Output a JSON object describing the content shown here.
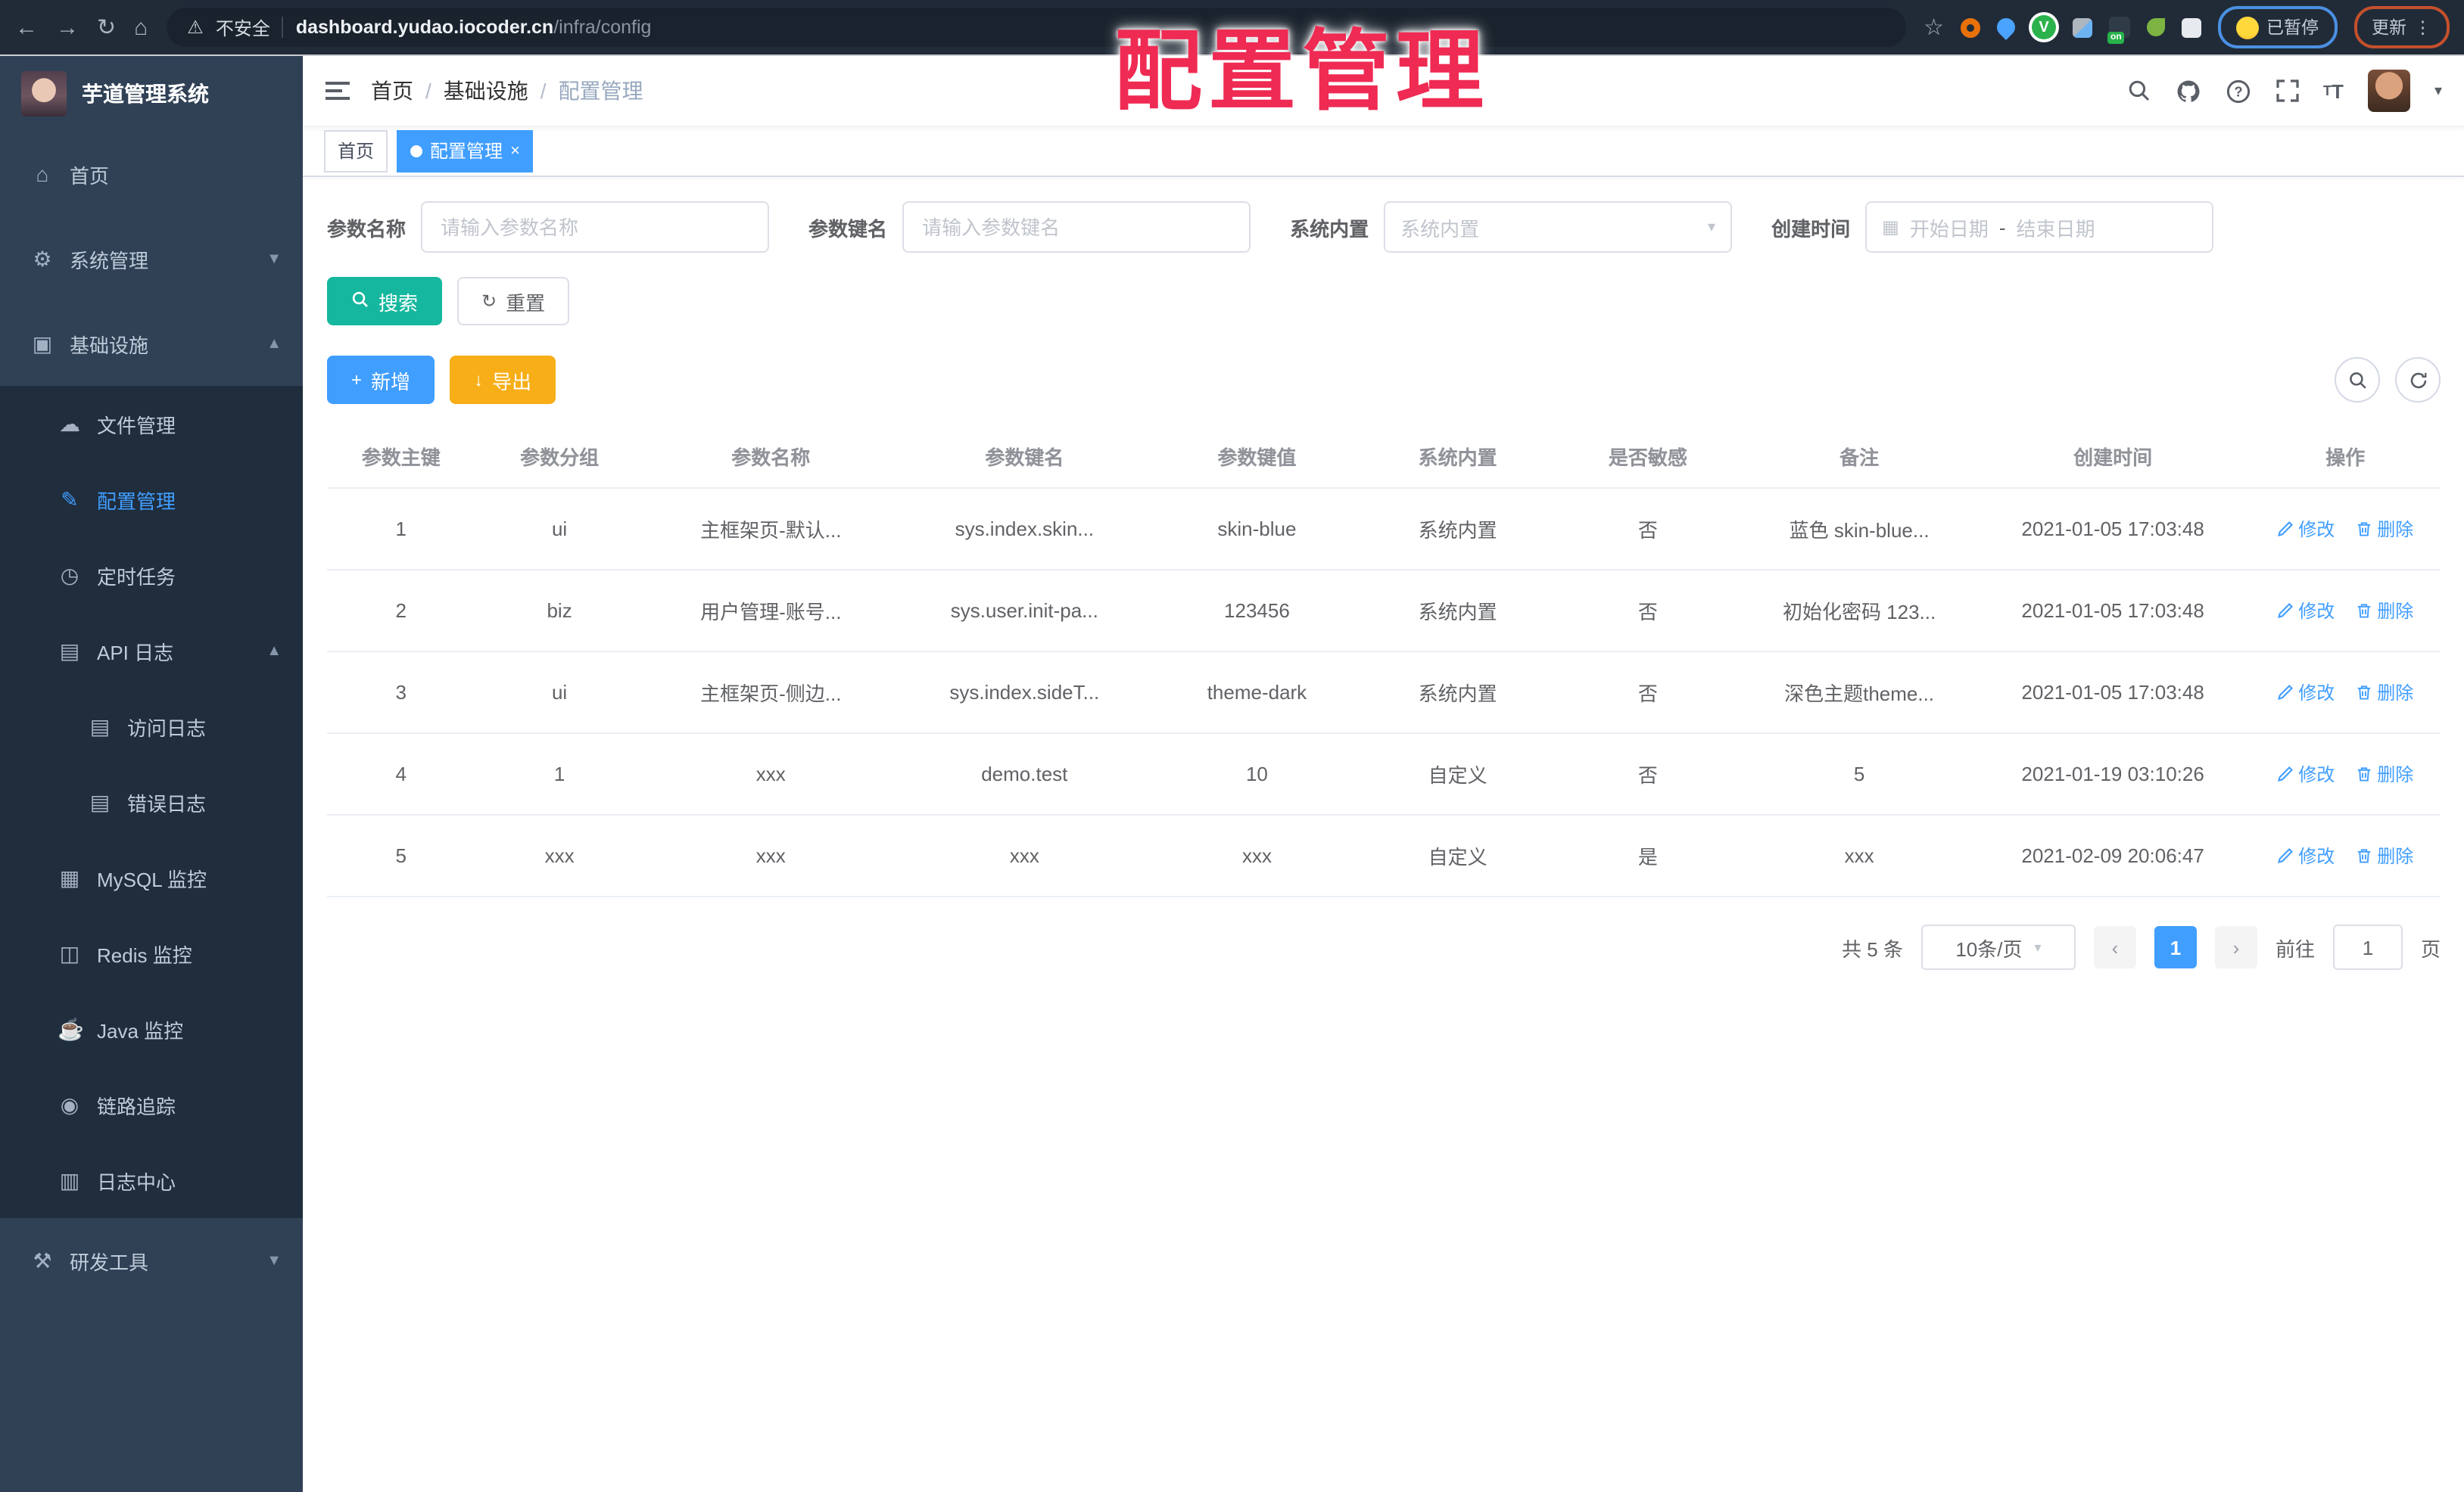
{
  "colors": {
    "primary": "#409eff",
    "search_teal": "#15b79e",
    "export_yellow": "#f7ae17",
    "sidebar_bg": "#304156",
    "sidebar_sub_bg": "#1f2d3d",
    "watermark_red": "#ef2b53"
  },
  "watermark": "配置管理",
  "icons": {
    "back": "←",
    "forward": "→",
    "reload": "↻",
    "home": "⌂",
    "warning": "⚠",
    "star": "☆",
    "chevron_up": "▲",
    "chevron_down": "▼",
    "caret": "▾",
    "close": "×",
    "kebab": "⋮",
    "plus": "+",
    "download": "↓",
    "refresh": "↻",
    "calendar": "▦",
    "prev": "‹",
    "next": "›",
    "slash": "/"
  },
  "chrome": {
    "insecure_label": "不安全",
    "url_host": "dashboard.yudao.iocoder.cn",
    "url_path": "/infra/config",
    "ext_v_label": "V",
    "ext_on_badge": "on",
    "paused_label": "已暂停",
    "update_label": "更新"
  },
  "sidebar": {
    "app_title": "芋道管理系统",
    "items": [
      {
        "id": "home",
        "label": "首页",
        "icon": "dashboard-icon",
        "glyph": "⌂",
        "level": 1
      },
      {
        "id": "system",
        "label": "系统管理",
        "icon": "gear-icon",
        "glyph": "⚙",
        "level": 1,
        "chevron": "down"
      },
      {
        "id": "infra",
        "label": "基础设施",
        "icon": "monitor-icon",
        "glyph": "▣",
        "level": 1,
        "chevron": "up"
      },
      {
        "id": "file",
        "label": "文件管理",
        "icon": "cloud-icon",
        "glyph": "☁",
        "level": 2
      },
      {
        "id": "config",
        "label": "配置管理",
        "icon": "edit-icon",
        "glyph": "✎",
        "level": 2,
        "active": true
      },
      {
        "id": "job",
        "label": "定时任务",
        "icon": "timer-icon",
        "glyph": "◷",
        "level": 2
      },
      {
        "id": "apilog",
        "label": "API 日志",
        "icon": "api-log-icon",
        "glyph": "▤",
        "level": 2,
        "chevron": "up"
      },
      {
        "id": "accesslog",
        "label": "访问日志",
        "icon": "access-log-icon",
        "glyph": "▤",
        "level": 3
      },
      {
        "id": "errorlog",
        "label": "错误日志",
        "icon": "error-log-icon",
        "glyph": "▤",
        "level": 3
      },
      {
        "id": "mysql",
        "label": "MySQL 监控",
        "icon": "mysql-icon",
        "glyph": "▦",
        "level": 2
      },
      {
        "id": "redis",
        "label": "Redis 监控",
        "icon": "redis-icon",
        "glyph": "◫",
        "level": 2
      },
      {
        "id": "java",
        "label": "Java 监控",
        "icon": "java-icon",
        "glyph": "☕",
        "level": 2
      },
      {
        "id": "trace",
        "label": "链路追踪",
        "icon": "eye-icon",
        "glyph": "◉",
        "level": 2
      },
      {
        "id": "logcenter",
        "label": "日志中心",
        "icon": "log-center-icon",
        "glyph": "▥",
        "level": 2
      },
      {
        "id": "tools",
        "label": "研发工具",
        "icon": "toolbox-icon",
        "glyph": "⚒",
        "level": 1,
        "chevron": "down"
      }
    ]
  },
  "navbar": {
    "breadcrumb": [
      "首页",
      "基础设施",
      "配置管理"
    ]
  },
  "tabs": [
    {
      "label": "首页"
    },
    {
      "label": "配置管理"
    }
  ],
  "filters": {
    "name_label": "参数名称",
    "name_placeholder": "请输入参数名称",
    "key_label": "参数键名",
    "key_placeholder": "请输入参数键名",
    "type_label": "系统内置",
    "type_placeholder": "系统内置",
    "date_label": "创建时间",
    "date_start_placeholder": "开始日期",
    "date_separator": "-",
    "date_end_placeholder": "结束日期",
    "search_label": "搜索",
    "reset_label": "重置"
  },
  "toolbar": {
    "add_label": "新增",
    "export_label": "导出"
  },
  "table": {
    "columns": [
      "参数主键",
      "参数分组",
      "参数名称",
      "参数键名",
      "参数键值",
      "系统内置",
      "是否敏感",
      "备注",
      "创建时间",
      "操作"
    ],
    "modify_label": "修改",
    "delete_label": "删除",
    "rows": [
      {
        "id": "1",
        "group": "ui",
        "name": "主框架页-默认...",
        "key": "sys.index.skin...",
        "value": "skin-blue",
        "type": "系统内置",
        "sensitive": "否",
        "remark": "蓝色 skin-blue...",
        "created": "2021-01-05 17:03:48"
      },
      {
        "id": "2",
        "group": "biz",
        "name": "用户管理-账号...",
        "key": "sys.user.init-pa...",
        "value": "123456",
        "type": "系统内置",
        "sensitive": "否",
        "remark": "初始化密码 123...",
        "created": "2021-01-05 17:03:48"
      },
      {
        "id": "3",
        "group": "ui",
        "name": "主框架页-侧边...",
        "key": "sys.index.sideT...",
        "value": "theme-dark",
        "type": "系统内置",
        "sensitive": "否",
        "remark": "深色主题theme...",
        "created": "2021-01-05 17:03:48"
      },
      {
        "id": "4",
        "group": "1",
        "name": "xxx",
        "key": "demo.test",
        "value": "10",
        "type": "自定义",
        "sensitive": "否",
        "remark": "5",
        "created": "2021-01-19 03:10:26"
      },
      {
        "id": "5",
        "group": "xxx",
        "name": "xxx",
        "key": "xxx",
        "value": "xxx",
        "type": "自定义",
        "sensitive": "是",
        "remark": "xxx",
        "created": "2021-02-09 20:06:47"
      }
    ]
  },
  "pagination": {
    "total": "共 5 条",
    "page_size": "10条/页",
    "current_page": "1",
    "goto_label": "前往",
    "goto_value": "1",
    "page_unit": "页"
  }
}
